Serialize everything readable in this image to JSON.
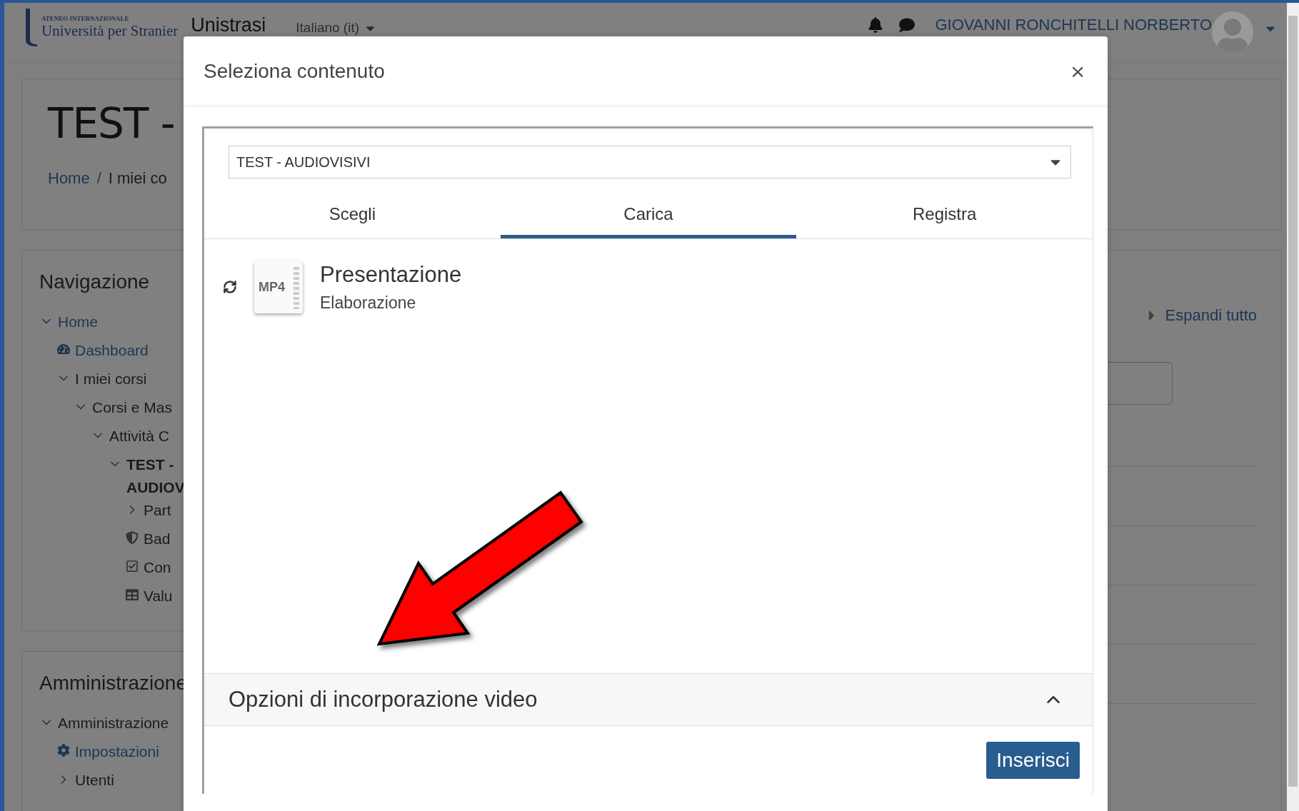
{
  "header": {
    "logo_caption": "ATENEO INTERNAZIONALE",
    "logo_name": "Università per Stranier",
    "site_name": "Unistrasi",
    "language": "Italiano (it)",
    "user_name": "GIOVANNI RONCHITELLI NORBERTO"
  },
  "page": {
    "title": "TEST -",
    "breadcrumb": [
      "Home",
      "I miei co"
    ],
    "breadcrumb_separator": "/",
    "expand_all": "Espandi tutto"
  },
  "navigation": {
    "title": "Navigazione",
    "items": [
      {
        "kind": "branch",
        "label": "Home",
        "expanded": true,
        "link": true,
        "children": [
          {
            "kind": "dashboard",
            "label": "Dashboard",
            "link": true
          },
          {
            "kind": "branch",
            "label": "I miei corsi",
            "expanded": true,
            "children": [
              {
                "kind": "branch",
                "label": "Corsi e Mas",
                "expanded": true,
                "children": [
                  {
                    "kind": "branch",
                    "label": "Attività C",
                    "expanded": true,
                    "children": [
                      {
                        "kind": "branch",
                        "label": "TEST - AUDIOV",
                        "expanded": true,
                        "current": true,
                        "children": [
                          {
                            "kind": "branch",
                            "label": "Part",
                            "expanded": false
                          },
                          {
                            "kind": "shield",
                            "label": "Bad"
                          },
                          {
                            "kind": "checkbox",
                            "label": "Con"
                          },
                          {
                            "kind": "table",
                            "label": "Valu"
                          }
                        ]
                      }
                    ]
                  }
                ]
              }
            ]
          }
        ]
      }
    ]
  },
  "administration": {
    "title": "Amministrazione",
    "items": [
      {
        "kind": "branch",
        "label": "Amministrazione",
        "expanded": true,
        "children": [
          {
            "kind": "gear",
            "label": "Impostazioni",
            "link": true
          },
          {
            "kind": "branch",
            "label": "Utenti",
            "expanded": false
          }
        ]
      }
    ]
  },
  "dialog": {
    "title": "Seleziona contenuto",
    "close": "×",
    "course_select": {
      "value": "TEST - AUDIOVISIVI"
    },
    "tabs": [
      {
        "label": "Scegli",
        "selected": false
      },
      {
        "label": "Carica",
        "selected": true
      },
      {
        "label": "Registra",
        "selected": false
      }
    ],
    "files": [
      {
        "type": "MP4",
        "name": "Presentazione",
        "status": "Elaborazione",
        "processing": true
      }
    ],
    "options_section": {
      "title": "Opzioni di incorporazione video",
      "expanded": false
    },
    "insert_button": "Inserisci"
  }
}
